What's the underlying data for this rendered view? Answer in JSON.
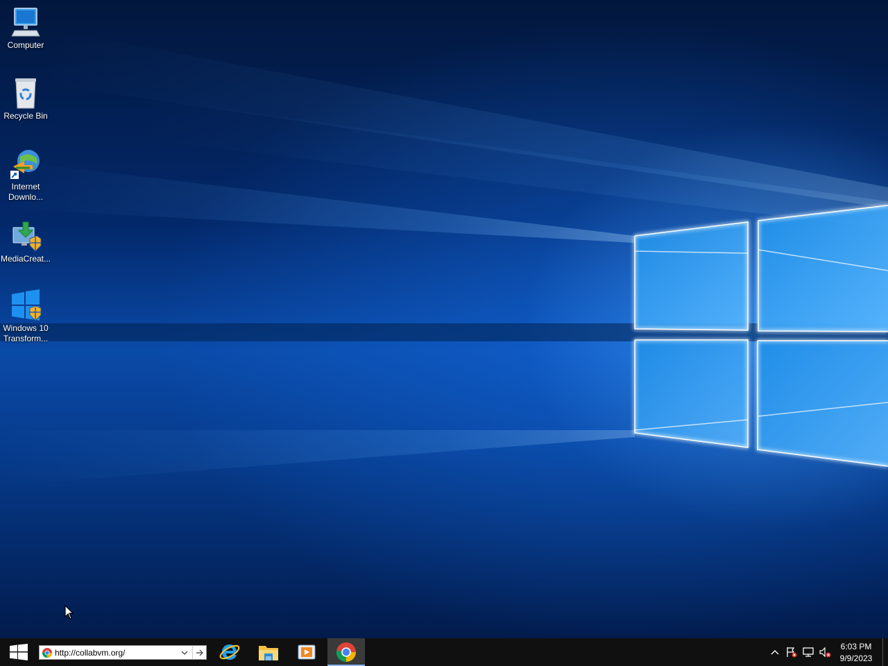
{
  "desktop": {
    "icons": [
      {
        "label": "Computer",
        "icon": "computer-icon"
      },
      {
        "label": "Recycle Bin",
        "icon": "recycle-bin-icon"
      },
      {
        "label": "Internet\nDownlo...",
        "icon": "internet-download-manager-icon"
      },
      {
        "label": "MediaCreat...",
        "icon": "media-creation-tool-icon"
      },
      {
        "label": "Windows 10\nTransform...",
        "icon": "windows-10-transformation-icon"
      }
    ]
  },
  "taskbar": {
    "start_icon": "windows-logo-icon",
    "address_bar": {
      "value": "http://collabvm.org/"
    },
    "apps": [
      {
        "name": "Internet Explorer",
        "icon": "internet-explorer-icon",
        "active": false
      },
      {
        "name": "File Explorer",
        "icon": "file-explorer-icon",
        "active": false
      },
      {
        "name": "Media Player",
        "icon": "media-player-icon",
        "active": false
      },
      {
        "name": "Google Chrome",
        "icon": "chrome-icon",
        "active": true
      }
    ],
    "tray": {
      "icons": [
        "show-hidden-icons-chevron",
        "action-center-flag-icon",
        "network-icon",
        "volume-muted-icon"
      ],
      "time": "6:03 PM",
      "date": "9/9/2023"
    }
  },
  "colors": {
    "taskbar_bg": "#101010",
    "wallpaper_blue": "#0a4aa8",
    "active_indicator": "#8ab4f8"
  }
}
